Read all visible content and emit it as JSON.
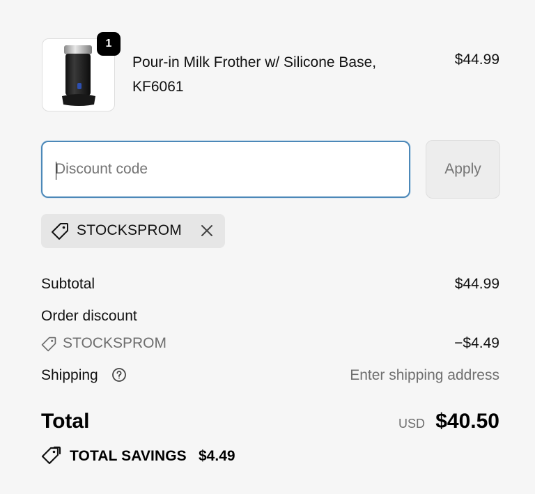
{
  "product": {
    "quantity": "1",
    "title_line1": "Pour-in Milk Frother w/ Silicone Base,",
    "title_line2": "KF6061",
    "price": "$44.99",
    "image_icon": "milk-frother-image"
  },
  "discount": {
    "placeholder": "Discount code",
    "value": "",
    "apply_label": "Apply",
    "applied_code": "STOCKSPROM"
  },
  "summary": {
    "subtotal_label": "Subtotal",
    "subtotal_value": "$44.99",
    "order_discount_label": "Order discount",
    "order_discount_code": "STOCKSPROM",
    "order_discount_value": "−$4.49",
    "shipping_label": "Shipping",
    "shipping_value": "Enter shipping address",
    "total_label": "Total",
    "currency": "USD",
    "total_value": "$40.50",
    "savings_label": "TOTAL SAVINGS",
    "savings_value": "$4.49"
  },
  "colors": {
    "background": "#f6f6f6",
    "focus_border": "#4c88b8",
    "badge": "#000000",
    "muted_text": "#6e6e6e"
  }
}
